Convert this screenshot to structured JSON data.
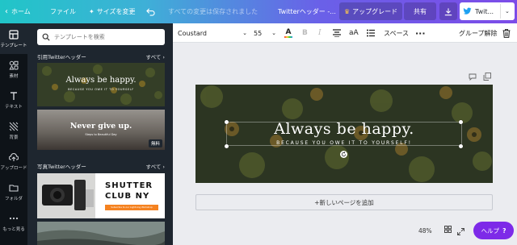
{
  "topbar": {
    "home": "ホーム",
    "file": "ファイル",
    "resize": "サイズを変更",
    "saved_status": "すべての変更は保存されました",
    "doc_title": "Twitterヘッダー -...",
    "upgrade": "アップグレード",
    "share": "共有",
    "twitter_button": "Twit..."
  },
  "sidebar": {
    "items": [
      {
        "label": "テンプレート",
        "icon": "template-icon"
      },
      {
        "label": "素材",
        "icon": "elements-icon"
      },
      {
        "label": "テキスト",
        "icon": "text-icon"
      },
      {
        "label": "背景",
        "icon": "background-icon"
      },
      {
        "label": "アップロード",
        "icon": "upload-icon"
      },
      {
        "label": "フォルダ",
        "icon": "folder-icon"
      },
      {
        "label": "もっと見る",
        "icon": "more-icon"
      }
    ]
  },
  "panel": {
    "search_placeholder": "テンプレートを検索",
    "section1": {
      "title": "引用Twitterヘッダー",
      "see_all": "すべて"
    },
    "section2": {
      "title": "写真Twitterヘッダー",
      "see_all": "すべて"
    },
    "templates": [
      {
        "text": "Always be happy.",
        "sub": "BECAUSE YOU OWE IT TO YOURSELF"
      },
      {
        "text": "Never give up.",
        "sub": "Steps to Beautiful Day",
        "badge": "無料"
      },
      {
        "line1": "SHUTTER",
        "line2": "CLUB NY",
        "tag": "Subscribe to our Lightning Workshop"
      }
    ]
  },
  "toolbar": {
    "font": "Coustard",
    "size": "55",
    "text_color_label": "A",
    "aA": "aA",
    "spacing": "スペース",
    "ungroup": "グループ解除"
  },
  "canvas": {
    "headline": "Always be happy.",
    "subline": "BECAUSE YOU OWE IT TO YOURSELF!",
    "add_page": "+新しいページを追加",
    "zoom": "48%",
    "help": "ヘルプ",
    "help_q": "?"
  },
  "colors": {
    "accent": "#7d2ae8",
    "rail": "#0e1318",
    "panel": "#1e262f"
  }
}
